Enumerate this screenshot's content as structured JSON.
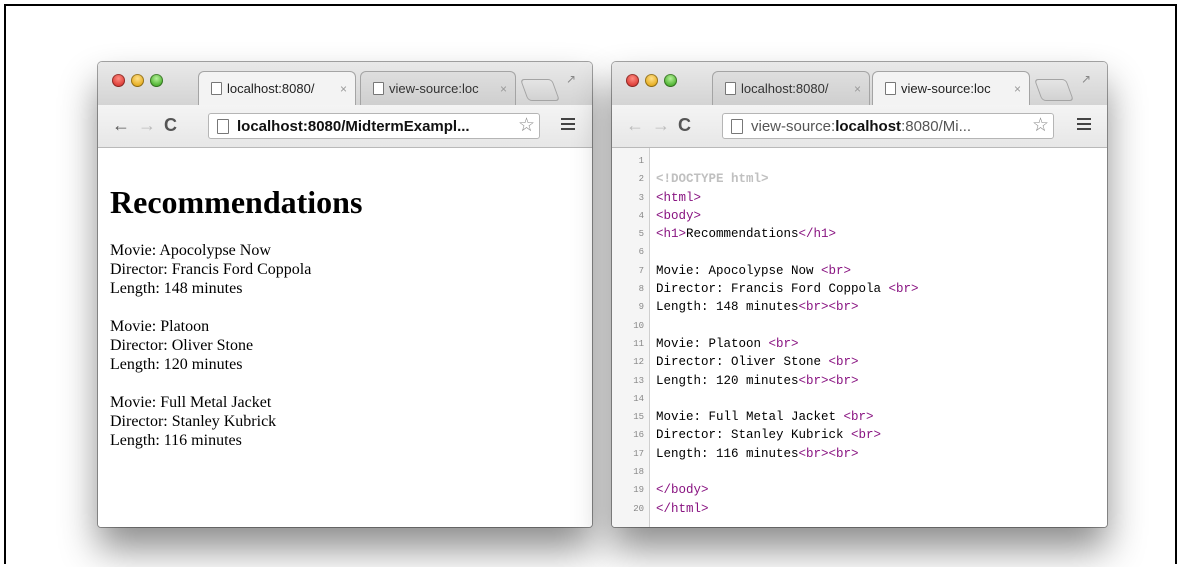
{
  "left_window": {
    "tabs": [
      {
        "title": "localhost:8080/",
        "active": true
      },
      {
        "title": "view-source:loc",
        "active": false
      }
    ],
    "url_host": "localhost",
    "url_rest": ":8080/MidtermExampl...",
    "page": {
      "heading": "Recommendations",
      "movies": [
        {
          "movie": "Movie: Apocolypse Now",
          "director": "Director: Francis Ford Coppola",
          "length": "Length: 148 minutes"
        },
        {
          "movie": "Movie: Platoon",
          "director": "Director: Oliver Stone",
          "length": "Length: 120 minutes"
        },
        {
          "movie": "Movie: Full Metal Jacket",
          "director": "Director: Stanley Kubrick",
          "length": "Length: 116 minutes"
        }
      ]
    }
  },
  "right_window": {
    "tabs": [
      {
        "title": "localhost:8080/",
        "active": false
      },
      {
        "title": "view-source:loc",
        "active": true
      }
    ],
    "url_prefix": "view-source:",
    "url_host": "localhost",
    "url_rest": ":8080/Mi...",
    "source_lines": [
      {
        "n": "1",
        "parts": []
      },
      {
        "n": "2",
        "parts": [
          {
            "t": "<!DOCTYPE html>",
            "c": "doctype"
          }
        ]
      },
      {
        "n": "3",
        "parts": [
          {
            "t": "<html>",
            "c": "tag"
          }
        ]
      },
      {
        "n": "4",
        "parts": [
          {
            "t": "<body>",
            "c": "tag"
          }
        ]
      },
      {
        "n": "5",
        "parts": [
          {
            "t": "<h1>",
            "c": "tag"
          },
          {
            "t": "Recommendations",
            "c": ""
          },
          {
            "t": "</h1>",
            "c": "tag"
          }
        ]
      },
      {
        "n": "6",
        "parts": []
      },
      {
        "n": "7",
        "parts": [
          {
            "t": "Movie: Apocolypse Now ",
            "c": ""
          },
          {
            "t": "<br>",
            "c": "tag"
          }
        ]
      },
      {
        "n": "8",
        "parts": [
          {
            "t": "Director: Francis Ford Coppola ",
            "c": ""
          },
          {
            "t": "<br>",
            "c": "tag"
          }
        ]
      },
      {
        "n": "9",
        "parts": [
          {
            "t": "Length: 148 minutes",
            "c": ""
          },
          {
            "t": "<br><br>",
            "c": "tag"
          }
        ]
      },
      {
        "n": "10",
        "parts": []
      },
      {
        "n": "11",
        "parts": [
          {
            "t": "Movie: Platoon ",
            "c": ""
          },
          {
            "t": "<br>",
            "c": "tag"
          }
        ]
      },
      {
        "n": "12",
        "parts": [
          {
            "t": "Director: Oliver Stone ",
            "c": ""
          },
          {
            "t": "<br>",
            "c": "tag"
          }
        ]
      },
      {
        "n": "13",
        "parts": [
          {
            "t": "Length: 120 minutes",
            "c": ""
          },
          {
            "t": "<br><br>",
            "c": "tag"
          }
        ]
      },
      {
        "n": "14",
        "parts": []
      },
      {
        "n": "15",
        "parts": [
          {
            "t": "Movie: Full Metal Jacket ",
            "c": ""
          },
          {
            "t": "<br>",
            "c": "tag"
          }
        ]
      },
      {
        "n": "16",
        "parts": [
          {
            "t": "Director: Stanley Kubrick ",
            "c": ""
          },
          {
            "t": "<br>",
            "c": "tag"
          }
        ]
      },
      {
        "n": "17",
        "parts": [
          {
            "t": "Length: 116 minutes",
            "c": ""
          },
          {
            "t": "<br><br>",
            "c": "tag"
          }
        ]
      },
      {
        "n": "18",
        "parts": []
      },
      {
        "n": "19",
        "parts": [
          {
            "t": "</body>",
            "c": "tag"
          }
        ]
      },
      {
        "n": "20",
        "parts": [
          {
            "t": "</html>",
            "c": "tag"
          }
        ]
      }
    ]
  },
  "icons": {
    "back": "←",
    "forward": "→",
    "reload": "C",
    "star": "☆",
    "close_tab": "×",
    "resize": "↗"
  },
  "colors": {
    "tag": "#881280",
    "doctype": "#c0c0c0"
  }
}
